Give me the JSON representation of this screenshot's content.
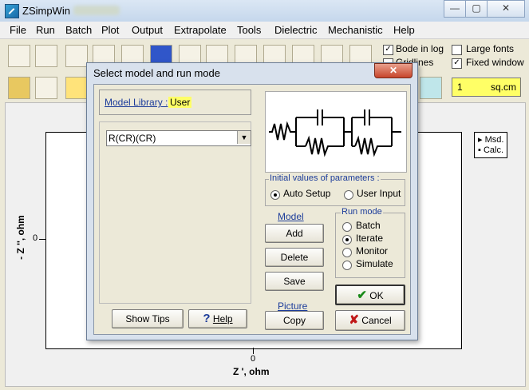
{
  "window": {
    "title": "ZSimpWin",
    "controls": {
      "minimize": "—",
      "maximize": "▢",
      "close": "✕"
    }
  },
  "menu": [
    "File",
    "Run",
    "Batch",
    "Plot",
    "Output",
    "Extrapolate",
    "Tools",
    "Dielectric",
    "Mechanistic",
    "Help"
  ],
  "options": {
    "bode_in_log": {
      "label": "Bode in log",
      "checked": true
    },
    "gridlines": {
      "label": "Gridlines",
      "checked": false
    },
    "large_fonts": {
      "label": "Large fonts",
      "checked": false
    },
    "fixed_window": {
      "label": "Fixed window",
      "checked": true
    }
  },
  "area": {
    "value": "1",
    "unit": "sq.cm"
  },
  "plot": {
    "xlabel": "Z ', ohm",
    "ylabel": "- Z '', ohm",
    "x_tick": "0",
    "y_tick": "0",
    "legend": [
      "Msd.",
      "Calc."
    ]
  },
  "dialog": {
    "title": "Select model and run mode",
    "close": "✕",
    "model_library_label": "Model Library :",
    "model_library_value": "User",
    "model_value": "R(CR)(CR)",
    "initial_values": {
      "label": "Initial values of parameters :",
      "options": [
        "Auto Setup",
        "User Input"
      ],
      "selected": "Auto Setup"
    },
    "model_section": "Model",
    "buttons": {
      "add": "Add",
      "delete": "Delete",
      "save": "Save",
      "copy": "Copy",
      "show_tips": "Show Tips",
      "help": "Help",
      "ok": "OK",
      "cancel": "Cancel"
    },
    "picture_link": "Picture",
    "run_mode": {
      "label": "Run mode",
      "options": [
        "Batch",
        "Iterate",
        "Monitor",
        "Simulate"
      ],
      "selected": "Iterate"
    }
  },
  "colors": {
    "accent": "#1c3c9a",
    "highlight": "#ffff66",
    "ok_check": "#1a8a1a",
    "cancel_x": "#c01818"
  }
}
